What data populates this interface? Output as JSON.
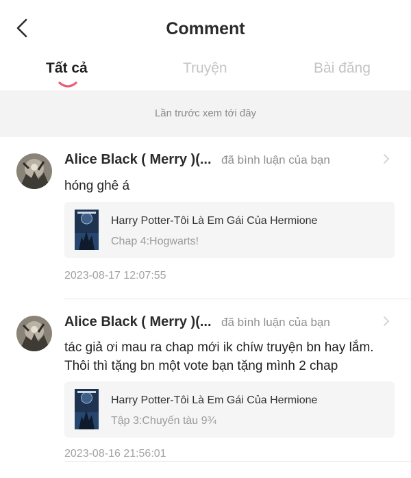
{
  "header": {
    "title": "Comment"
  },
  "tabs": [
    {
      "label": "Tất cả",
      "active": true
    },
    {
      "label": "Truyện",
      "active": false
    },
    {
      "label": "Bài đăng",
      "active": false
    }
  ],
  "banner": {
    "text": "Lần trước xem tới đây"
  },
  "colors": {
    "accent": "#ef5a78",
    "muted": "#8f8f8f",
    "card_bg": "#f5f5f5",
    "banner_bg": "#f3f3f3"
  },
  "comments": [
    {
      "user": "Alice Black ( Merry )(...",
      "action": "đã bình luận của bạn",
      "text": "hóng ghê á",
      "story": {
        "title": "Harry Potter-Tôi Là Em Gái Của Hermione",
        "chapter": "Chap 4:Hogwarts!"
      },
      "time": "2023-08-17 12:07:55"
    },
    {
      "user": "Alice Black ( Merry )(...",
      "action": "đã bình luận của bạn",
      "text": "tác giả ơi mau ra chap mới ik chíw truyện bn hay lắm. Thôi thì tặng bn một vote bạn tặng mình 2 chap",
      "story": {
        "title": "Harry Potter-Tôi Là Em Gái Của Hermione",
        "chapter": "Tập 3:Chuyến tàu 9¾"
      },
      "time": "2023-08-16 21:56:01"
    }
  ],
  "icons": {
    "back": "chevron-left-icon",
    "more": "chevron-right-icon"
  }
}
